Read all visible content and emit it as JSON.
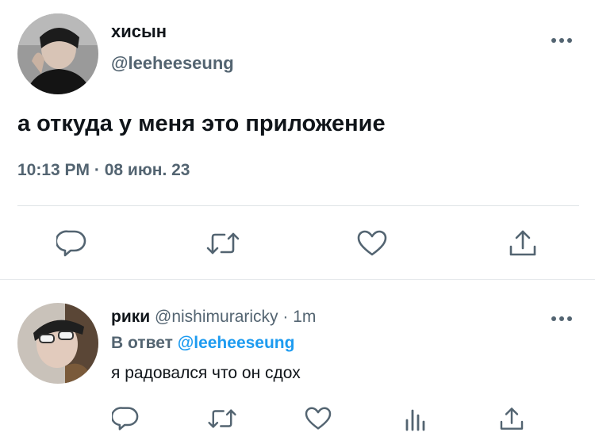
{
  "main_tweet": {
    "display_name": "хисын",
    "handle": "@leeheeseung",
    "text": "а откуда у меня это приложение",
    "time": "10:13 PM",
    "separator": "·",
    "date": "08 июн. 23"
  },
  "reply_tweet": {
    "display_name": "рики",
    "handle": "@nishimuraricky",
    "separator": "·",
    "age": "1m",
    "reply_prefix": "В ответ",
    "reply_to_handle": "@leeheeseung",
    "text": "я радовался что он сдох"
  },
  "icons": {
    "actions_main": [
      "reply-icon",
      "retweet-icon",
      "like-icon",
      "share-icon"
    ],
    "actions_reply": [
      "reply-icon",
      "retweet-icon",
      "like-icon",
      "analytics-icon",
      "share-icon"
    ],
    "more": "more-icon"
  },
  "colors": {
    "text_primary": "#0f1419",
    "text_secondary": "#536471",
    "link": "#1d9bf0",
    "divider": "#dfe3e6"
  }
}
